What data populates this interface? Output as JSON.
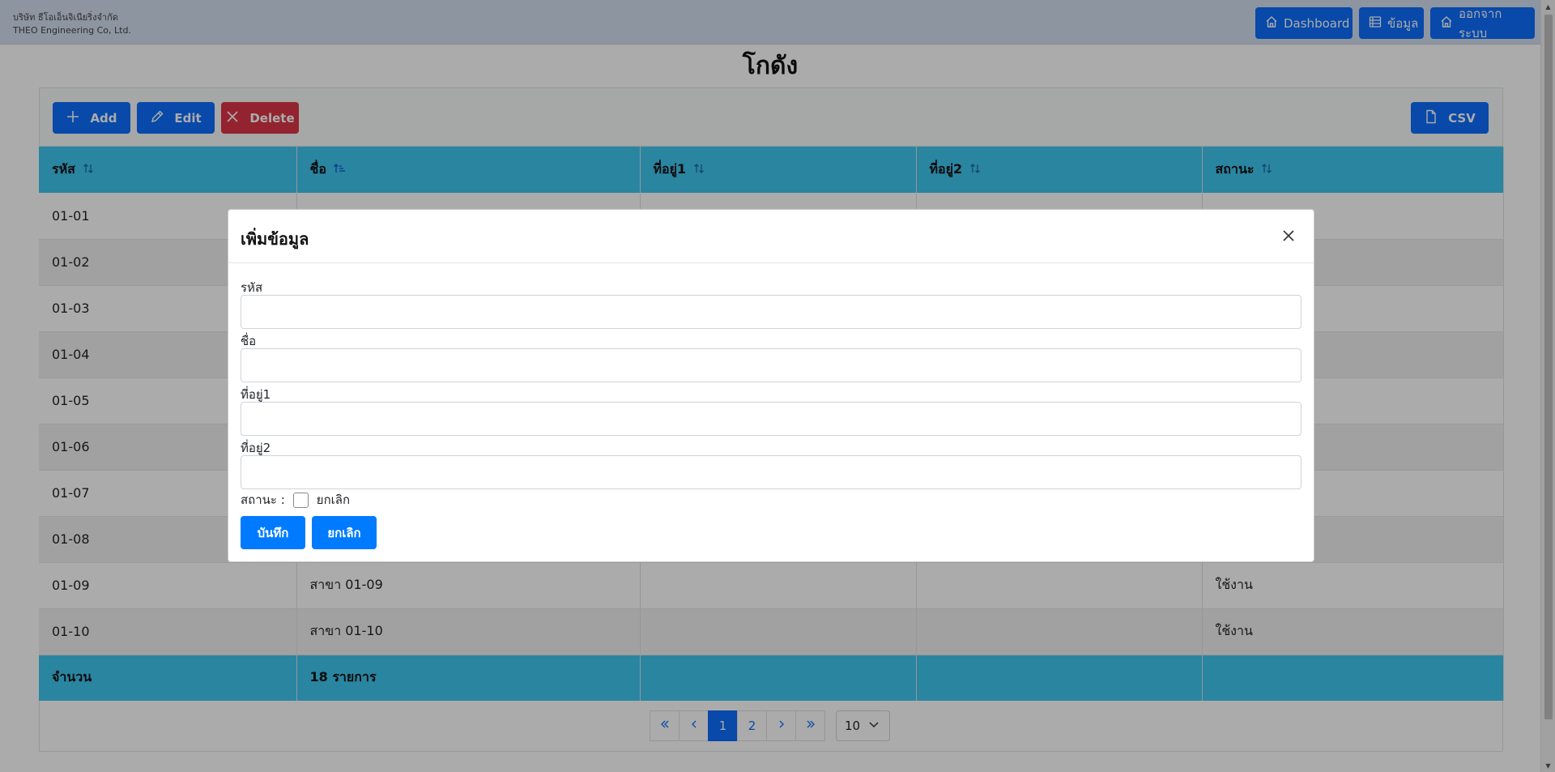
{
  "header": {
    "company_th": "บริษัท ธีโอเอ็นจิเนียริ่งจำกัด",
    "company_en": "THEO Engineering Co, Ltd.",
    "nav": [
      {
        "label": "Dashboard",
        "icon": "home-icon"
      },
      {
        "label": "ข้อมูล",
        "icon": "list-icon"
      },
      {
        "label": "ออกจากระบบ",
        "icon": "home-icon"
      }
    ]
  },
  "page": {
    "title": "โกดัง"
  },
  "toolbar": {
    "add_label": "Add",
    "edit_label": "Edit",
    "delete_label": "Delete",
    "csv_label": "CSV"
  },
  "table": {
    "columns": [
      "รหัส",
      "ชื่อ",
      "ที่อยู่1",
      "ที่อยู่2",
      "สถานะ"
    ],
    "rows": [
      {
        "code": "01-01",
        "name": "",
        "addr1": "",
        "addr2": "",
        "status": ""
      },
      {
        "code": "01-02",
        "name": "",
        "addr1": "",
        "addr2": "",
        "status": ""
      },
      {
        "code": "01-03",
        "name": "",
        "addr1": "",
        "addr2": "",
        "status": ""
      },
      {
        "code": "01-04",
        "name": "",
        "addr1": "",
        "addr2": "",
        "status": ""
      },
      {
        "code": "01-05",
        "name": "",
        "addr1": "",
        "addr2": "",
        "status": ""
      },
      {
        "code": "01-06",
        "name": "",
        "addr1": "",
        "addr2": "",
        "status": ""
      },
      {
        "code": "01-07",
        "name": "",
        "addr1": "",
        "addr2": "",
        "status": ""
      },
      {
        "code": "01-08",
        "name": "",
        "addr1": "",
        "addr2": "",
        "status": ""
      },
      {
        "code": "01-09",
        "name": "สาขา 01-09",
        "addr1": "",
        "addr2": "",
        "status": "ใช้งาน"
      },
      {
        "code": "01-10",
        "name": "สาขา 01-10",
        "addr1": "",
        "addr2": "",
        "status": "ใช้งาน"
      }
    ],
    "footer": {
      "label": "จำนวน",
      "count": "18 รายการ"
    }
  },
  "pagination": {
    "pages": [
      "1",
      "2"
    ],
    "current": "1",
    "rows_per_page": "10"
  },
  "modal": {
    "title": "เพิ่มข้อมูล",
    "fields": {
      "code_label": "รหัส",
      "name_label": "ชื่อ",
      "addr1_label": "ที่อยู่1",
      "addr2_label": "ที่อยู่2"
    },
    "status_label": "สถานะ :",
    "checkbox_label": "ยกเลิก",
    "save_label": "บันทึก",
    "cancel_label": "ยกเลิก"
  },
  "colors": {
    "primary": "#0d6efd",
    "danger": "#dc3545",
    "table_header": "#3fc6f1",
    "header_bg": "#d3dff0"
  }
}
